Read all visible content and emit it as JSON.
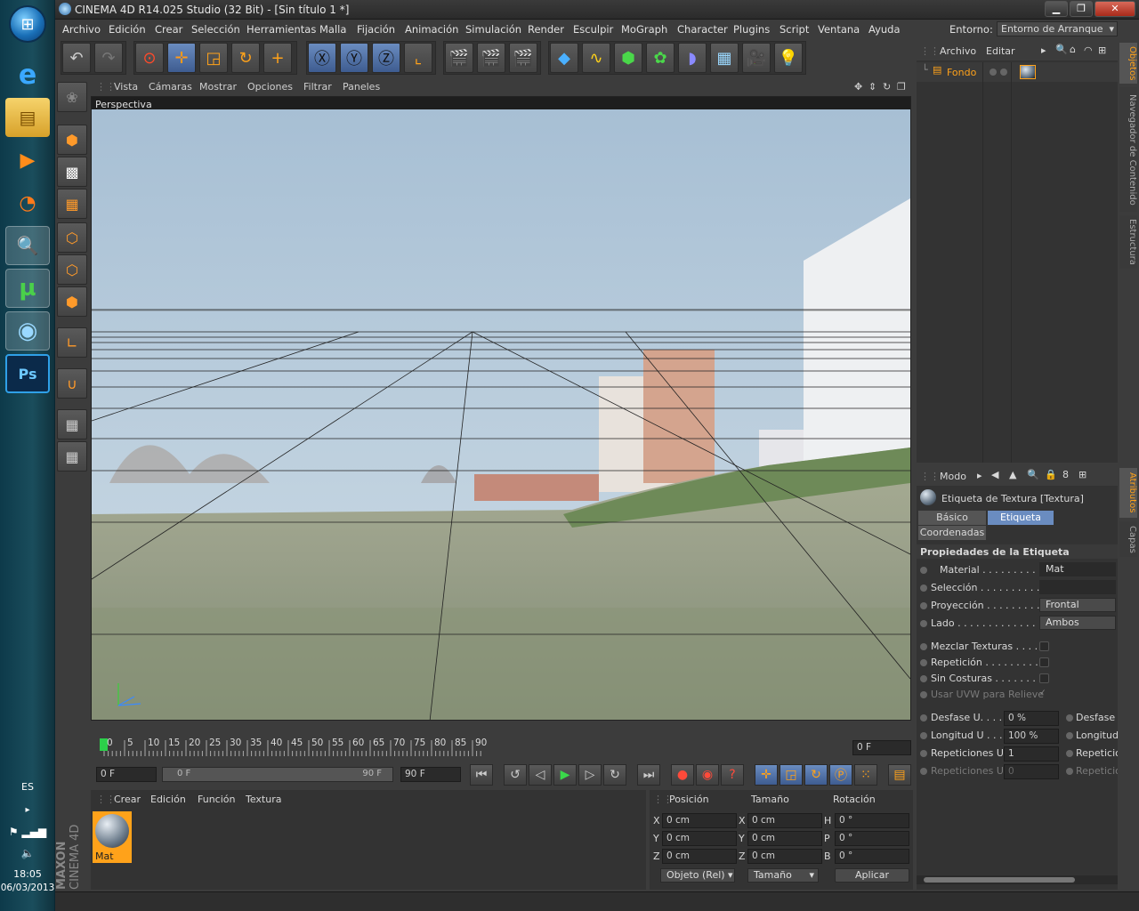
{
  "taskbar": {
    "lang": "ES",
    "time": "18:05",
    "date": "06/03/2013",
    "apps": [
      {
        "label": "e",
        "icon": "internet-explorer-icon"
      },
      {
        "label": "▤",
        "icon": "file-explorer-icon"
      },
      {
        "label": "▶",
        "icon": "media-player-icon"
      },
      {
        "label": "◔",
        "icon": "blender-icon"
      },
      {
        "label": "🔍",
        "icon": "search-icon"
      },
      {
        "label": "µ",
        "icon": "utorrent-icon"
      },
      {
        "label": "◉",
        "icon": "cinema4d-icon"
      },
      {
        "label": "Ps",
        "icon": "photoshop-icon"
      }
    ]
  },
  "window": {
    "title": "CINEMA 4D R14.025 Studio (32 Bit) - [Sin título 1 *]"
  },
  "menu": [
    "Archivo",
    "Edición",
    "Crear",
    "Selección",
    "Herramientas",
    "Malla",
    "Fijación",
    "Animación",
    "Simulación",
    "Render",
    "Esculpir",
    "MoGraph",
    "Character",
    "Plugins",
    "Script",
    "Ventana",
    "Ayuda"
  ],
  "layout": {
    "label": "Entorno:",
    "value": "Entorno de Arranque"
  },
  "viewport": {
    "menu": [
      "Vista",
      "Cámaras",
      "Mostrar",
      "Opciones",
      "Filtrar",
      "Paneles"
    ],
    "name": "Perspectiva"
  },
  "timeline": {
    "ticks": [
      "0",
      "5",
      "10",
      "15",
      "20",
      "25",
      "30",
      "35",
      "40",
      "45",
      "50",
      "55",
      "60",
      "65",
      "70",
      "75",
      "80",
      "85",
      "90"
    ],
    "current": "0 F"
  },
  "transport": {
    "start": "0 F",
    "range_start": "0 F",
    "range_end": "90 F",
    "end": "90 F"
  },
  "material_manager": {
    "menu": [
      "Crear",
      "Edición",
      "Función",
      "Textura"
    ],
    "material": "Mat",
    "brand_top": "MAXON",
    "brand_bottom": "CINEMA 4D"
  },
  "coordinates": {
    "headers": [
      "Posición",
      "Tamaño",
      "Rotación"
    ],
    "rows": [
      {
        "a": "X",
        "pos": "0 cm",
        "b": "X",
        "size": "0 cm",
        "c": "H",
        "rot": "0 °"
      },
      {
        "a": "Y",
        "pos": "0 cm",
        "b": "Y",
        "size": "0 cm",
        "c": "P",
        "rot": "0 °"
      },
      {
        "a": "Z",
        "pos": "0 cm",
        "b": "Z",
        "size": "0 cm",
        "c": "B",
        "rot": "0 °"
      }
    ],
    "mode": "Objeto (Rel)",
    "size_mode": "Tamaño",
    "apply": "Aplicar"
  },
  "objects": {
    "menu": [
      "Archivo",
      "Editar"
    ],
    "items": [
      {
        "name": "Fondo"
      }
    ],
    "tabs": [
      "Objetos",
      "Navegador de Contenido",
      "Estructura"
    ]
  },
  "attributes": {
    "mode": "Modo",
    "title": "Etiqueta de Textura [Textura]",
    "tabs": [
      "Básico",
      "Etiqueta",
      "Coordenadas"
    ],
    "section": "Propiedades de la Etiqueta",
    "props": [
      {
        "label": "Material . . . . . . . . .",
        "value": "Mat"
      },
      {
        "label": "Selección . . . . . . . . . . .",
        "value": ""
      },
      {
        "label": "Proyección . . . . . . . . . .",
        "value": "Frontal"
      },
      {
        "label": "Lado . . . . . . . . . . . . . . .",
        "value": "Ambos"
      }
    ],
    "checks": [
      {
        "label": "Mezclar Texturas . . . . ."
      },
      {
        "label": "Repetición . . . . . . . . . ."
      },
      {
        "label": "Sin Costuras . . . . . . . . ."
      },
      {
        "label": "Usar UVW para Relieve"
      }
    ],
    "offsets": [
      {
        "label": "Desfase U. . . . .",
        "value": "0 %",
        "label2": "Desfase V"
      },
      {
        "label": "Longitud U . . .",
        "value": "100 %",
        "label2": "Longitud"
      },
      {
        "label": "Repeticiones U",
        "value": "1",
        "label2": "Repeticio"
      },
      {
        "label": "Repeticiones U",
        "value": "0",
        "label2": "Repeticio"
      }
    ],
    "side_tabs": [
      "Atributos",
      "Capas"
    ]
  }
}
